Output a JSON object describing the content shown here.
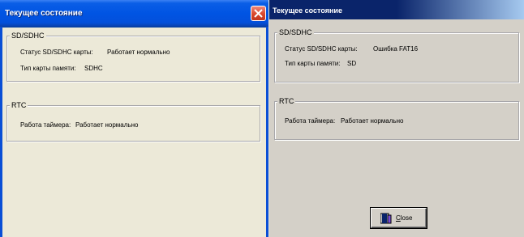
{
  "left_window": {
    "title": "Текущее состояние",
    "sd_group": {
      "legend": "SD/SDHC",
      "status_label": "Статус SD/SDHC карты:",
      "status_value": "Работает нормально",
      "type_label": "Тип карты памяти:",
      "type_value": "SDHC"
    },
    "rtc_group": {
      "legend": "RTC",
      "timer_label": "Работа таймера:",
      "timer_value": "Работает нормально"
    },
    "close_icon": "close-x-icon"
  },
  "right_window": {
    "title": "Текущее состояние",
    "sd_group": {
      "legend": "SD/SDHC",
      "status_label": "Статус SD/SDHC карты:",
      "status_value": "Ошибка FAT16",
      "type_label": "Тип карты памяти:",
      "type_value": "SD"
    },
    "rtc_group": {
      "legend": "RTC",
      "timer_label": "Работа таймера:",
      "timer_value": "Работает нормально"
    },
    "close_button": {
      "label": "Close",
      "icon": "door-icon"
    }
  },
  "colors": {
    "xp_titlebar": "#0054e3",
    "xp_close": "#d9472b",
    "classic_titlebar": "#0a246a",
    "xp_face": "#ece9d8",
    "classic_face": "#d4d0c8"
  }
}
